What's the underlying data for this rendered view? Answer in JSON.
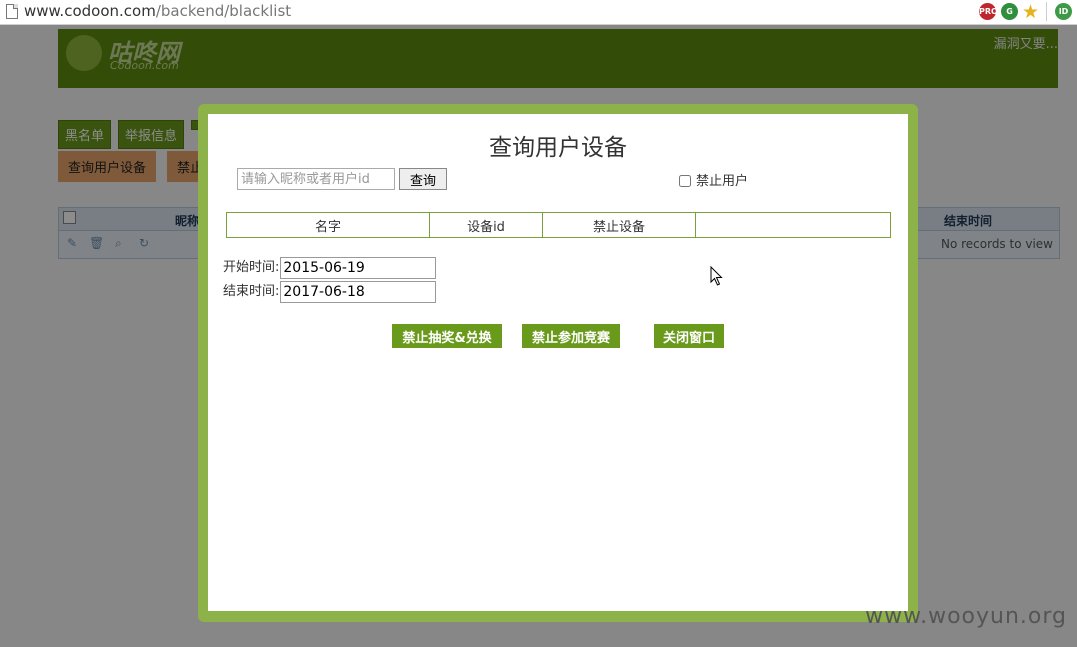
{
  "browser": {
    "url_domain": "www.codoon.com",
    "url_path": "/backend/blacklist",
    "ext_pro_label": "PRO",
    "ext_g_label": "G",
    "ext_id_label": "ID"
  },
  "site": {
    "logo_text": "咕咚网",
    "logo_sub": "Codoon.com",
    "header_right": "漏洞又要..."
  },
  "nav": {
    "buttons": [
      "黑名单",
      "举报信息"
    ],
    "sub_buttons": [
      "查询用户设备",
      "禁止"
    ]
  },
  "grid": {
    "headers": [
      "昵称",
      "结束时间"
    ],
    "empty_text": "No records to view"
  },
  "modal": {
    "title": "查询用户设备",
    "search_placeholder": "请输入昵称或者用户id",
    "search_button": "查询",
    "ban_user_label": "禁止用户",
    "table_headers": [
      "名字",
      "设备id",
      "禁止设备",
      ""
    ],
    "start_label": "开始时间:",
    "start_value": "2015-06-19",
    "end_label": "结束时间:",
    "end_value": "2017-06-18",
    "actions": [
      "禁止抽奖&兑换",
      "禁止参加竞赛",
      "关闭窗口"
    ]
  },
  "watermark": "www.wooyun.org",
  "colors": {
    "header_green": "#5d8a0e",
    "modal_border": "#8db24a",
    "action_green": "#6a9a1c"
  }
}
